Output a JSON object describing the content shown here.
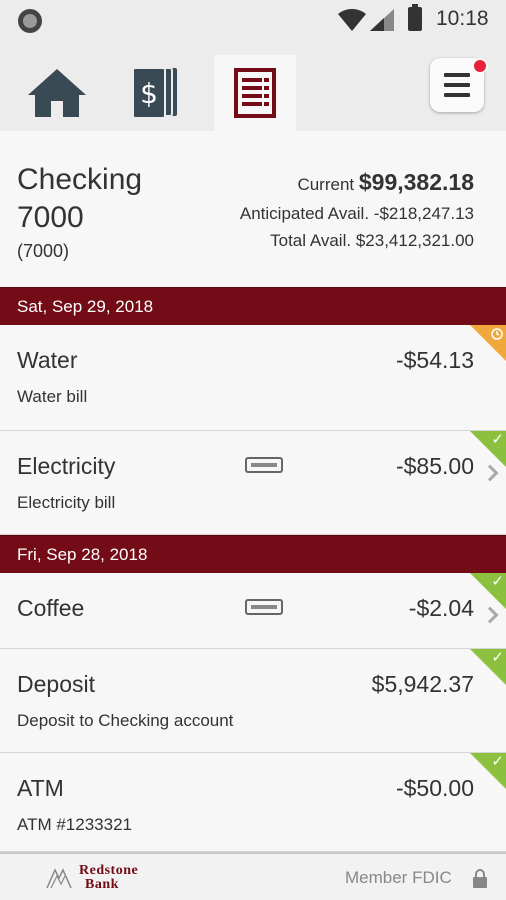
{
  "status_bar": {
    "time": "10:18"
  },
  "tabs": [
    {
      "id": "home",
      "icon": "home-icon"
    },
    {
      "id": "transfer",
      "icon": "money-icon"
    },
    {
      "id": "activity",
      "icon": "register-icon",
      "active": true
    }
  ],
  "menu": {
    "icon": "hamburger-menu-icon",
    "notification": true
  },
  "account": {
    "name": "Checking 7000",
    "number": "(7000)",
    "current_label": "Current",
    "current_value": "$99,382.18",
    "anticipated_label": "Anticipated Avail.",
    "anticipated_value": "-$218,247.13",
    "total_label": "Total Avail.",
    "total_value": "$23,412,321.00"
  },
  "dates": [
    "Sat, Sep 29, 2018",
    "Fri, Sep 28, 2018"
  ],
  "transactions": [
    {
      "title": "Water",
      "desc": "Water bill",
      "amount": "-$54.13",
      "status": "pending"
    },
    {
      "title": "Electricity",
      "desc": "Electricity bill",
      "amount": "-$85.00",
      "status": "cleared",
      "card": true
    },
    {
      "title": "Coffee",
      "desc": "",
      "amount": "-$2.04",
      "status": "cleared",
      "card": true
    },
    {
      "title": "Deposit",
      "desc": "Deposit to Checking account",
      "amount": "$5,942.37",
      "status": "cleared"
    },
    {
      "title": "ATM",
      "desc": "ATM #1233321",
      "amount": "-$50.00",
      "status": "cleared"
    }
  ],
  "footer": {
    "logo_line1": "Redstone",
    "logo_line2": "Bank",
    "fdic_label": "Member FDIC"
  },
  "colors": {
    "brand": "#730c17",
    "cleared": "#8cc13f",
    "pending": "#f0a83c",
    "notification": "#e8203a"
  }
}
